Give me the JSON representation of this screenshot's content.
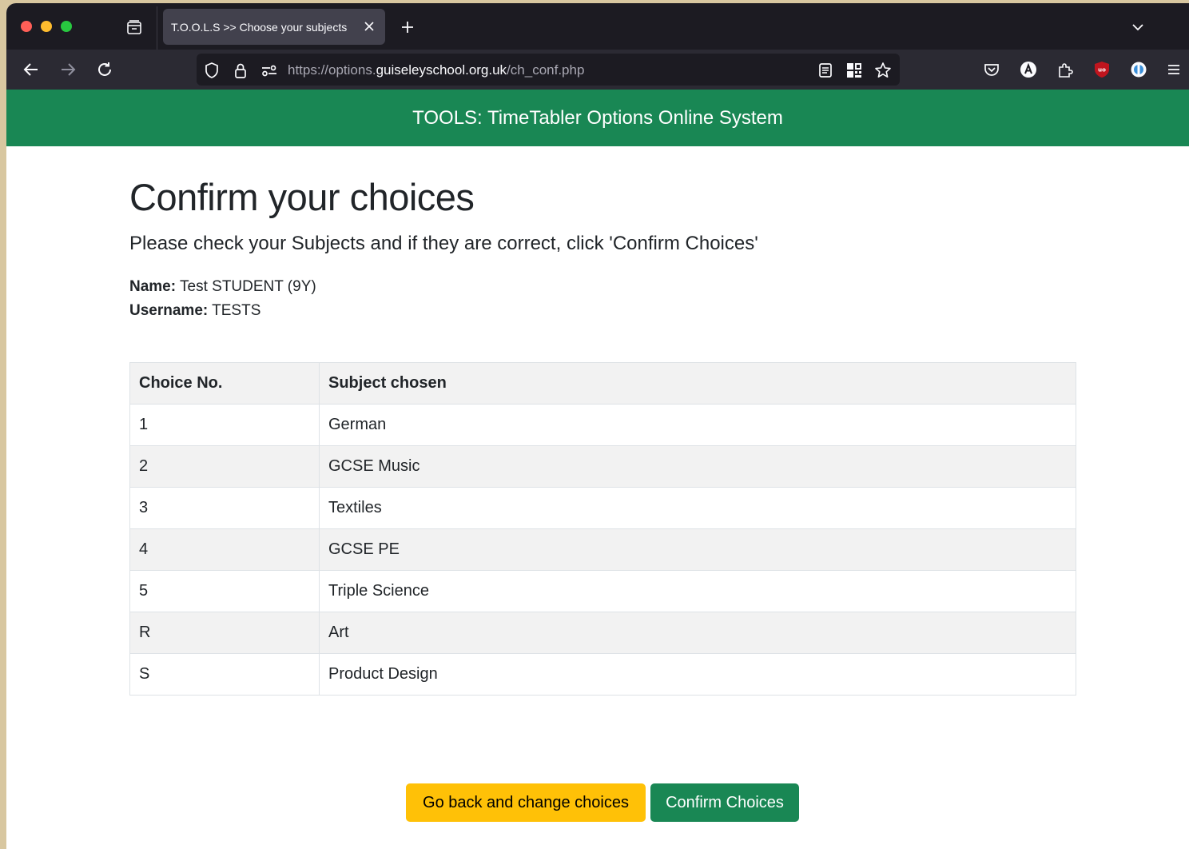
{
  "browser": {
    "tab_title": "T.O.O.L.S >> Choose your subjects",
    "url_prefix": "https://options.",
    "url_domain": "guiseleyschool.org.uk",
    "url_path": "/ch_conf.php"
  },
  "site": {
    "header_title": "TOOLS: TimeTabler Options Online System"
  },
  "page": {
    "title": "Confirm your choices",
    "lead": "Please check your Subjects and if they are correct, click 'Confirm Choices'",
    "name_label": "Name:",
    "name_value": "Test STUDENT (9Y)",
    "username_label": "Username:",
    "username_value": "TESTS"
  },
  "table": {
    "headers": [
      "Choice No.",
      "Subject chosen"
    ],
    "rows": [
      {
        "no": "1",
        "subject": "German"
      },
      {
        "no": "2",
        "subject": "GCSE Music"
      },
      {
        "no": "3",
        "subject": "Textiles"
      },
      {
        "no": "4",
        "subject": "GCSE PE"
      },
      {
        "no": "5",
        "subject": "Triple Science"
      },
      {
        "no": "R",
        "subject": "Art"
      },
      {
        "no": "S",
        "subject": "Product Design"
      }
    ]
  },
  "buttons": {
    "back": "Go back and change choices",
    "confirm": "Confirm Choices"
  },
  "colors": {
    "brand_green": "#198754",
    "warning_yellow": "#ffc107",
    "browser_dark": "#1c1b22",
    "ublock_red": "#c0151e"
  },
  "icons": {
    "tab_list": "tab-list-icon",
    "close": "close-icon",
    "new_tab": "plus-icon",
    "back": "arrow-left-icon",
    "forward": "arrow-right-icon",
    "reload": "reload-icon",
    "shield": "shield-icon",
    "lock": "lock-icon",
    "permissions": "permissions-icon",
    "reader": "reader-view-icon",
    "qr": "qr-code-icon",
    "bookmark": "star-icon",
    "pocket": "pocket-icon",
    "account": "account-icon",
    "extensions": "puzzle-icon",
    "ublock": "ublock-icon",
    "addon": "addon-icon",
    "menu": "hamburger-menu-icon"
  }
}
